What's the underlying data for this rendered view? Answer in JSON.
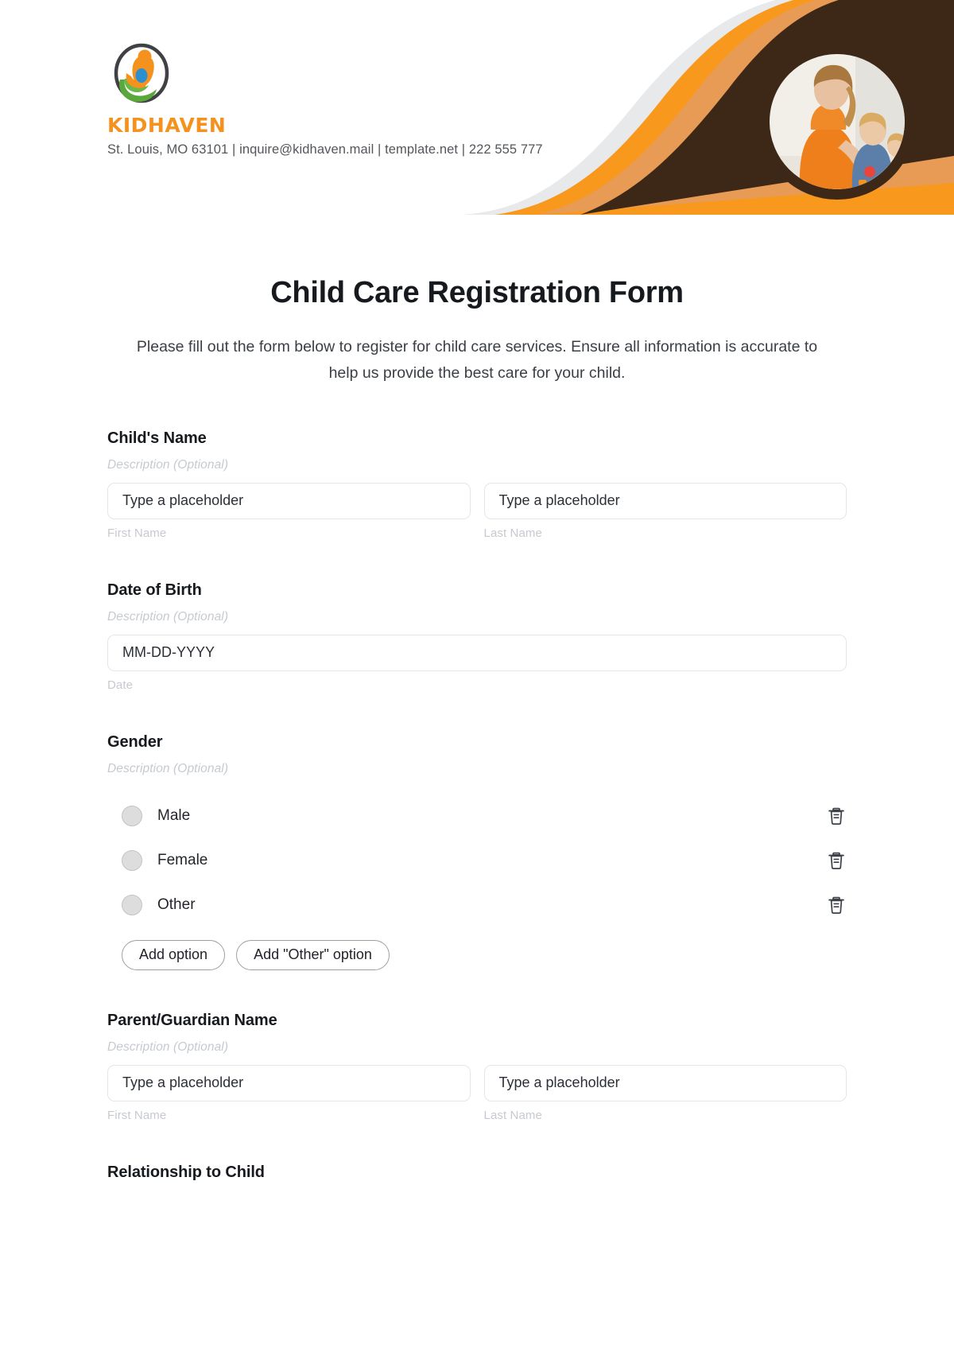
{
  "brand": {
    "logo_icon": "kidhaven-parent-child-logo",
    "name": "KIDHAVEN",
    "contact": "St. Louis, MO 63101 | inquire@kidhaven.mail | template.net | 222 555 777"
  },
  "header": {
    "photo_alt": "caregiver-with-children-photo",
    "colors": {
      "dark_brown": "#3d2817",
      "orange": "#f8981d",
      "muted_orange": "#e89b54",
      "light_gray": "#e8e9eb",
      "brand_orange": "#f5921e"
    }
  },
  "form": {
    "title": "Child Care Registration Form",
    "subtitle": "Please fill out the form below to register for child care services. Ensure all information is accurate to help us provide the best care for your child.",
    "description_placeholder": "Description (Optional)",
    "fields": [
      {
        "label": "Child's Name",
        "description": "Description (Optional)",
        "type": "name",
        "inputs": [
          {
            "value": "Type a placeholder",
            "sub_label": "First Name"
          },
          {
            "value": "Type a placeholder",
            "sub_label": "Last Name"
          }
        ]
      },
      {
        "label": "Date of Birth",
        "description": "Description (Optional)",
        "type": "date",
        "inputs": [
          {
            "value": "MM-DD-YYYY",
            "sub_label": "Date"
          }
        ]
      },
      {
        "label": "Gender",
        "description": "Description (Optional)",
        "type": "radio",
        "options": [
          {
            "label": "Male",
            "delete_icon": "trash-icon"
          },
          {
            "label": "Female",
            "delete_icon": "trash-icon"
          },
          {
            "label": "Other",
            "delete_icon": "trash-icon"
          }
        ],
        "buttons": [
          {
            "label": "Add option"
          },
          {
            "label": "Add \"Other\" option"
          }
        ]
      },
      {
        "label": "Parent/Guardian Name",
        "description": "Description (Optional)",
        "type": "name",
        "inputs": [
          {
            "value": "Type a placeholder",
            "sub_label": "First Name"
          },
          {
            "value": "Type a placeholder",
            "sub_label": "Last Name"
          }
        ]
      },
      {
        "label": "Relationship to Child",
        "description": "",
        "type": "partial",
        "inputs": []
      }
    ]
  }
}
